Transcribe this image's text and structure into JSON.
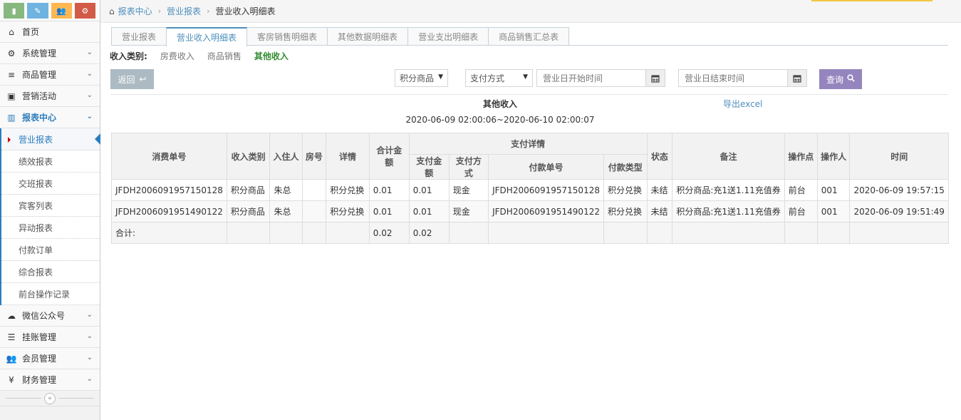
{
  "colors": {
    "accent": "#4c8fbd",
    "active_type": "#2e8b2e",
    "query_btn": "#9585bf",
    "back_btn": "#abbac3"
  },
  "shortcuts": [
    {
      "name": "signal-icon",
      "color": "#87b87f",
      "glyph": "▮"
    },
    {
      "name": "pencil-icon",
      "color": "#6fb3e0",
      "glyph": "✎"
    },
    {
      "name": "users-icon",
      "color": "#ffb752",
      "glyph": "👥"
    },
    {
      "name": "cogs-icon",
      "color": "#d15b47",
      "glyph": "⚙"
    }
  ],
  "sidebar": {
    "items": [
      {
        "label": "首页",
        "icon": "home-icon",
        "glyph": "⌂",
        "chevron": false
      },
      {
        "label": "系统管理",
        "icon": "gear-icon",
        "glyph": "⚙",
        "chevron": true
      },
      {
        "label": "商品管理",
        "icon": "database-icon",
        "glyph": "≡",
        "chevron": true
      },
      {
        "label": "营销活动",
        "icon": "gift-icon",
        "glyph": "▣",
        "chevron": true
      },
      {
        "label": "报表中心",
        "icon": "bar-chart-icon",
        "glyph": "▥",
        "chevron": true,
        "active": true
      }
    ],
    "sub_items": [
      {
        "label": "营业报表",
        "active": true
      },
      {
        "label": "绩效报表"
      },
      {
        "label": "交班报表"
      },
      {
        "label": "宾客列表"
      },
      {
        "label": "异动报表"
      },
      {
        "label": "付款订单"
      },
      {
        "label": "综合报表"
      },
      {
        "label": "前台操作记录"
      }
    ],
    "items_after": [
      {
        "label": "微信公众号",
        "icon": "cloud-icon",
        "glyph": "☁",
        "chevron": true
      },
      {
        "label": "挂账管理",
        "icon": "list-icon",
        "glyph": "☰",
        "chevron": true
      },
      {
        "label": "会员管理",
        "icon": "users-icon",
        "glyph": "👥",
        "chevron": true
      },
      {
        "label": "财务管理",
        "icon": "cutlery-icon",
        "glyph": "¥",
        "chevron": true
      }
    ]
  },
  "breadcrumb": {
    "home": "报表中心",
    "level2": "营业报表",
    "current": "营业收入明细表"
  },
  "tabs": [
    "营业报表",
    "营业收入明细表",
    "客房销售明细表",
    "其他数据明细表",
    "营业支出明细表",
    "商品销售汇总表"
  ],
  "active_tab": 1,
  "income_types": {
    "title": "收入类别:",
    "items": [
      "房费收入",
      "商品销售",
      "其他收入"
    ],
    "active": 2
  },
  "filters": {
    "back_label": "返回",
    "category_select": "积分商品",
    "payment_select": "支付方式",
    "start_placeholder": "营业日开始时间",
    "end_placeholder": "营业日结束时间",
    "query_label": "查询"
  },
  "report": {
    "title": "其他收入",
    "export_label": "导出excel",
    "range": "2020-06-09 02:00:06~2020-06-10 02:00:07"
  },
  "table": {
    "headers": {
      "order_no": "消费单号",
      "category": "收入类别",
      "guest": "入住人",
      "room": "房号",
      "detail": "详情",
      "total": "合计金额",
      "payment_group": "支付详情",
      "pay_amount": "支付金额",
      "pay_method": "支付方式",
      "pay_no": "付款单号",
      "pay_type": "付款类型",
      "status": "状态",
      "remark": "备注",
      "point": "操作点",
      "operator": "操作人",
      "time": "时间"
    },
    "rows": [
      {
        "order_no": "JFDH2006091957150128",
        "category": "积分商品",
        "guest": "朱总",
        "room": "",
        "detail": "积分兑换",
        "total": "0.01",
        "pay_amount": "0.01",
        "pay_method": "现金",
        "pay_no": "JFDH2006091957150128",
        "pay_type": "积分兑换",
        "status": "未结",
        "remark": "积分商品:充1送1.11充值券",
        "point": "前台",
        "operator": "001",
        "time": "2020-06-09 19:57:15"
      },
      {
        "order_no": "JFDH2006091951490122",
        "category": "积分商品",
        "guest": "朱总",
        "room": "",
        "detail": "积分兑换",
        "total": "0.01",
        "pay_amount": "0.01",
        "pay_method": "现金",
        "pay_no": "JFDH2006091951490122",
        "pay_type": "积分兑换",
        "status": "未结",
        "remark": "积分商品:充1送1.11充值券",
        "point": "前台",
        "operator": "001",
        "time": "2020-06-09 19:51:49"
      }
    ],
    "total_row": {
      "label": "合计:",
      "total": "0.02",
      "pay_amount": "0.02"
    }
  }
}
